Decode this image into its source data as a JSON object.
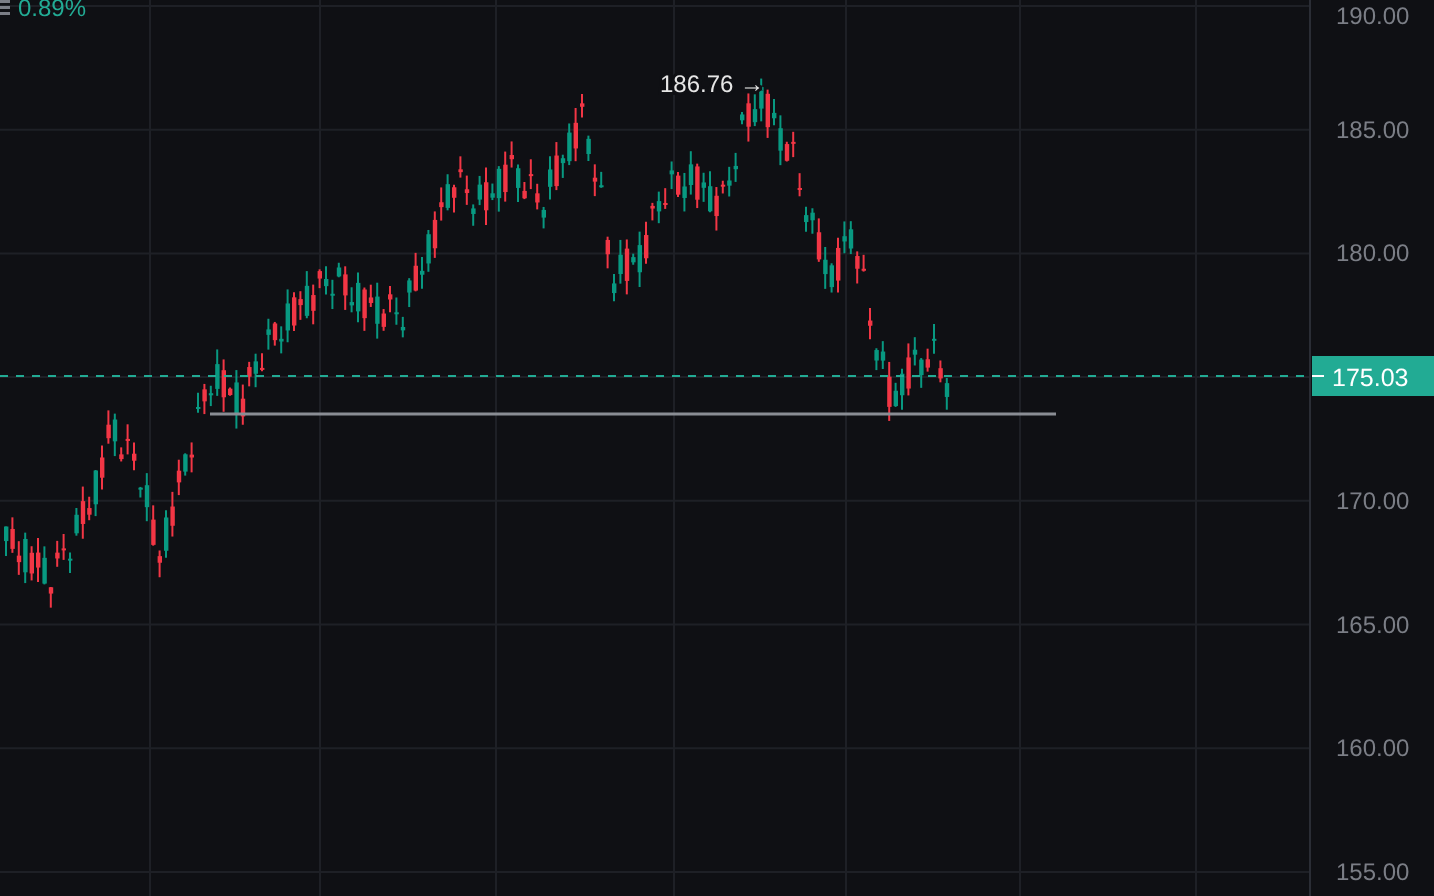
{
  "header": {
    "change": "0.89%"
  },
  "price_axis": {
    "ticks": [
      "190.00",
      "185.00",
      "180.00",
      "170.00",
      "165.00",
      "160.00",
      "155.00"
    ]
  },
  "high_marker": {
    "label": "186.76",
    "arrow": "→"
  },
  "last_price": {
    "label": "175.03"
  }
}
